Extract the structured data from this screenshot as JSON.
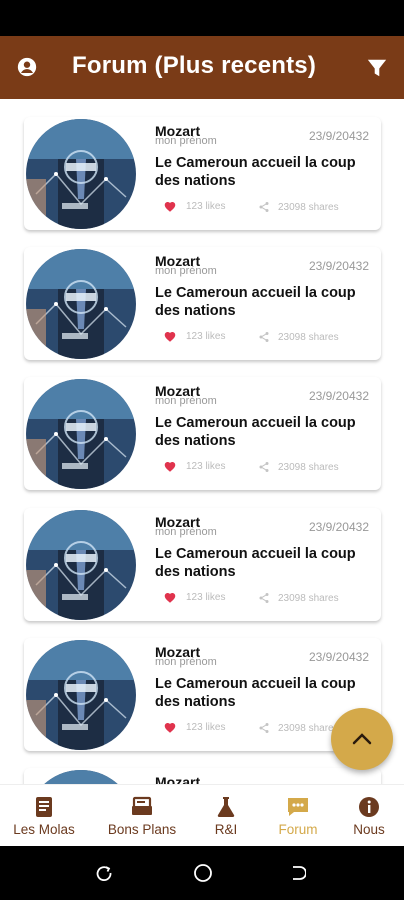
{
  "header": {
    "title": "Forum (Plus recents)",
    "account_icon": "account-circle-icon",
    "filter_icon": "filter-icon",
    "background": "#7a3b17"
  },
  "posts": [
    {
      "author": "Mozart",
      "subtitle": "mon prénom",
      "date": "23/9/20432",
      "headline": "Le Cameroun accueil la coup des nations",
      "likes": "123 likes",
      "shares": "23098 shares"
    },
    {
      "author": "Mozart",
      "subtitle": "mon prénom",
      "date": "23/9/20432",
      "headline": "Le Cameroun accueil la coup des nations",
      "likes": "123 likes",
      "shares": "23098 shares"
    },
    {
      "author": "Mozart",
      "subtitle": "mon prénom",
      "date": "23/9/20432",
      "headline": "Le Cameroun accueil la coup des nations",
      "likes": "123 likes",
      "shares": "23098 shares"
    },
    {
      "author": "Mozart",
      "subtitle": "mon prénom",
      "date": "23/9/20432",
      "headline": "Le Cameroun accueil la coup des nations",
      "likes": "123 likes",
      "shares": "23098 shares"
    },
    {
      "author": "Mozart",
      "subtitle": "mon prénom",
      "date": "23/9/20432",
      "headline": "Le Cameroun accueil la coup des nations",
      "likes": "123 likes",
      "shares": "23098 shares"
    },
    {
      "author": "Mozart"
    }
  ],
  "fab": {
    "icon": "chevron-up-icon",
    "color": "#d4a94a"
  },
  "bottom_nav": {
    "items": [
      {
        "label": "Les Molas",
        "icon": "book-icon"
      },
      {
        "label": "Bons Plans",
        "icon": "tag-icon"
      },
      {
        "label": "R&I",
        "icon": "flask-icon"
      },
      {
        "label": "Forum",
        "icon": "chat-icon"
      },
      {
        "label": "Nous",
        "icon": "info-icon"
      }
    ],
    "active_index": 3,
    "colors": {
      "default": "#6b3a1f",
      "active": "#d4a94a"
    }
  }
}
